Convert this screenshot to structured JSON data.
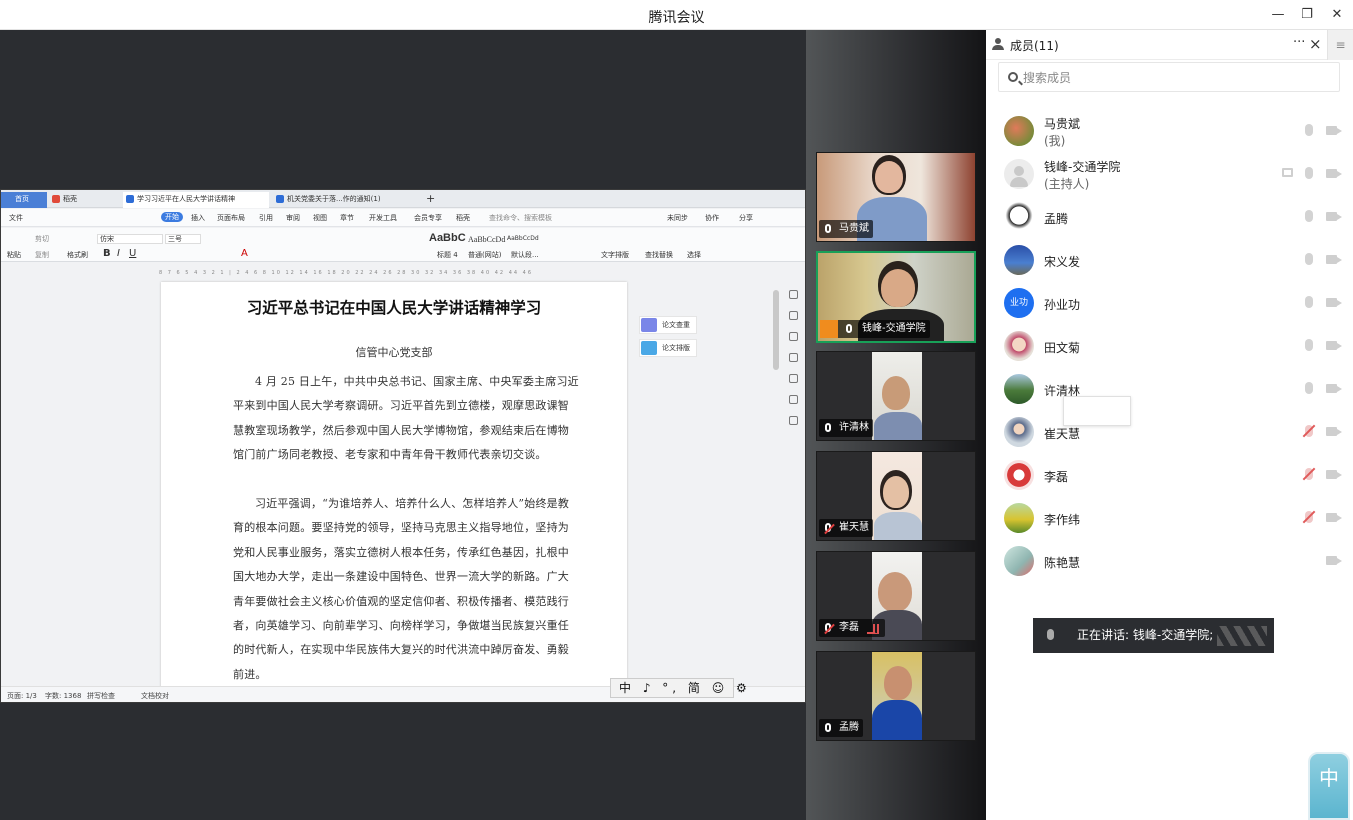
{
  "window": {
    "title": "腾讯会议"
  },
  "wps": {
    "tabs": [
      "首页",
      "稻壳",
      "学习习近平在人民大学讲话精神",
      "机关党委关于落...作的通知(1)"
    ],
    "menu": [
      "文件",
      "开始",
      "插入",
      "页面布局",
      "引用",
      "审阅",
      "视图",
      "章节",
      "开发工具",
      "会员专享",
      "稻壳",
      "查找命令、搜索模板",
      "未同步",
      "协作",
      "分享"
    ],
    "ribbon": {
      "paste": "粘贴",
      "cut": "剪切",
      "copy": "复制",
      "format_painter": "格式刷",
      "font": "仿宋",
      "size": "三号",
      "style1": "AaBbC",
      "style1_name": "标题 4",
      "style2": "AaBbCcDd",
      "style2_name": "普通(网站)",
      "style3": "AaBbCcDd",
      "style3_name": "默认段...",
      "text_layout": "文字排版",
      "find_replace": "查找替换",
      "select": "选择"
    },
    "ruler": "8 7 6 5 4 3 2 1 | 2 4 6 8 10 12 14 16 18 20 22 24 26 28 30 32 34 36 38 40 42 44 46",
    "doc": {
      "title": "习近平总书记在中国人民大学讲话精神学习",
      "subtitle": "信管中心党支部",
      "para1": "4 月 25 日上午，中共中央总书记、国家主席、中央军委主席习近平来到中国人民大学考察调研。习近平首先到立德楼，观摩思政课智慧教室现场教学，然后参观中国人民大学博物馆，参观结束后在博物馆门前广场同老教授、老专家和中青年骨干教师代表亲切交谈。",
      "para2": "习近平强调，“为谁培养人、培养什么人、怎样培养人”始终是教育的根本问题。要坚持党的领导，坚持马克思主义指导地位，坚持为党和人民事业服务，落实立德树人根本任务，传承红色基因，扎根中国大地办大学，走出一条建设中国特色、世界一流大学的新路。广大青年要做社会主义核心价值观的坚定信仰者、积极传播者、模范践行者，向英雄学习、向前辈学习、向榜样学习，争做堪当民族复兴重任的时代新人，在实现中华民族伟大复兴的时代洪流中踔厉奋发、勇毅前进。"
    },
    "plugins": [
      "论文查重",
      "论文排版"
    ],
    "status": {
      "page": "页面: 1/3",
      "words": "字数: 1368",
      "spell": "拼写检查",
      "proof": "文档校对"
    },
    "ime": "中 ♪ °, 简 ☺ ⚙"
  },
  "video_tiles": [
    {
      "name": "马贵斌",
      "muted": false,
      "active": false
    },
    {
      "name": "钱峰-交通学院",
      "muted": false,
      "active": true
    },
    {
      "name": "许清林",
      "muted": false,
      "active": false
    },
    {
      "name": "崔天慧",
      "muted": true,
      "active": false
    },
    {
      "name": "李磊",
      "muted": true,
      "active": false
    },
    {
      "name": "孟腾",
      "muted": false,
      "active": false
    }
  ],
  "panel": {
    "title": "成员(11)",
    "more": "···",
    "close": "×",
    "search_placeholder": "搜索成员",
    "members": [
      {
        "name": "马贵斌",
        "role": "(我)",
        "muted": false
      },
      {
        "name": "钱峰-交通学院",
        "role": "(主持人)",
        "muted": false,
        "sharing": true
      },
      {
        "name": "孟腾",
        "role": "",
        "muted": false
      },
      {
        "name": "宋义发",
        "role": "",
        "muted": false
      },
      {
        "name": "孙业功",
        "role": "",
        "muted": false,
        "avatar_text": "业功"
      },
      {
        "name": "田文菊",
        "role": "",
        "muted": false
      },
      {
        "name": "许清林",
        "role": "",
        "muted": false
      },
      {
        "name": "崔天慧",
        "role": "",
        "muted": true
      },
      {
        "name": "李磊",
        "role": "",
        "muted": true
      },
      {
        "name": "李作纬",
        "role": "",
        "muted": true
      },
      {
        "name": "陈艳慧",
        "role": "",
        "muted": null
      }
    ]
  },
  "speaking": "正在讲话: 钱峰-交通学院;",
  "ime_float": "中",
  "icons": [
    "minimize-icon",
    "maximize-icon",
    "close-icon",
    "members-icon",
    "search-icon",
    "mic-icon",
    "camera-icon",
    "screen-share-icon"
  ]
}
